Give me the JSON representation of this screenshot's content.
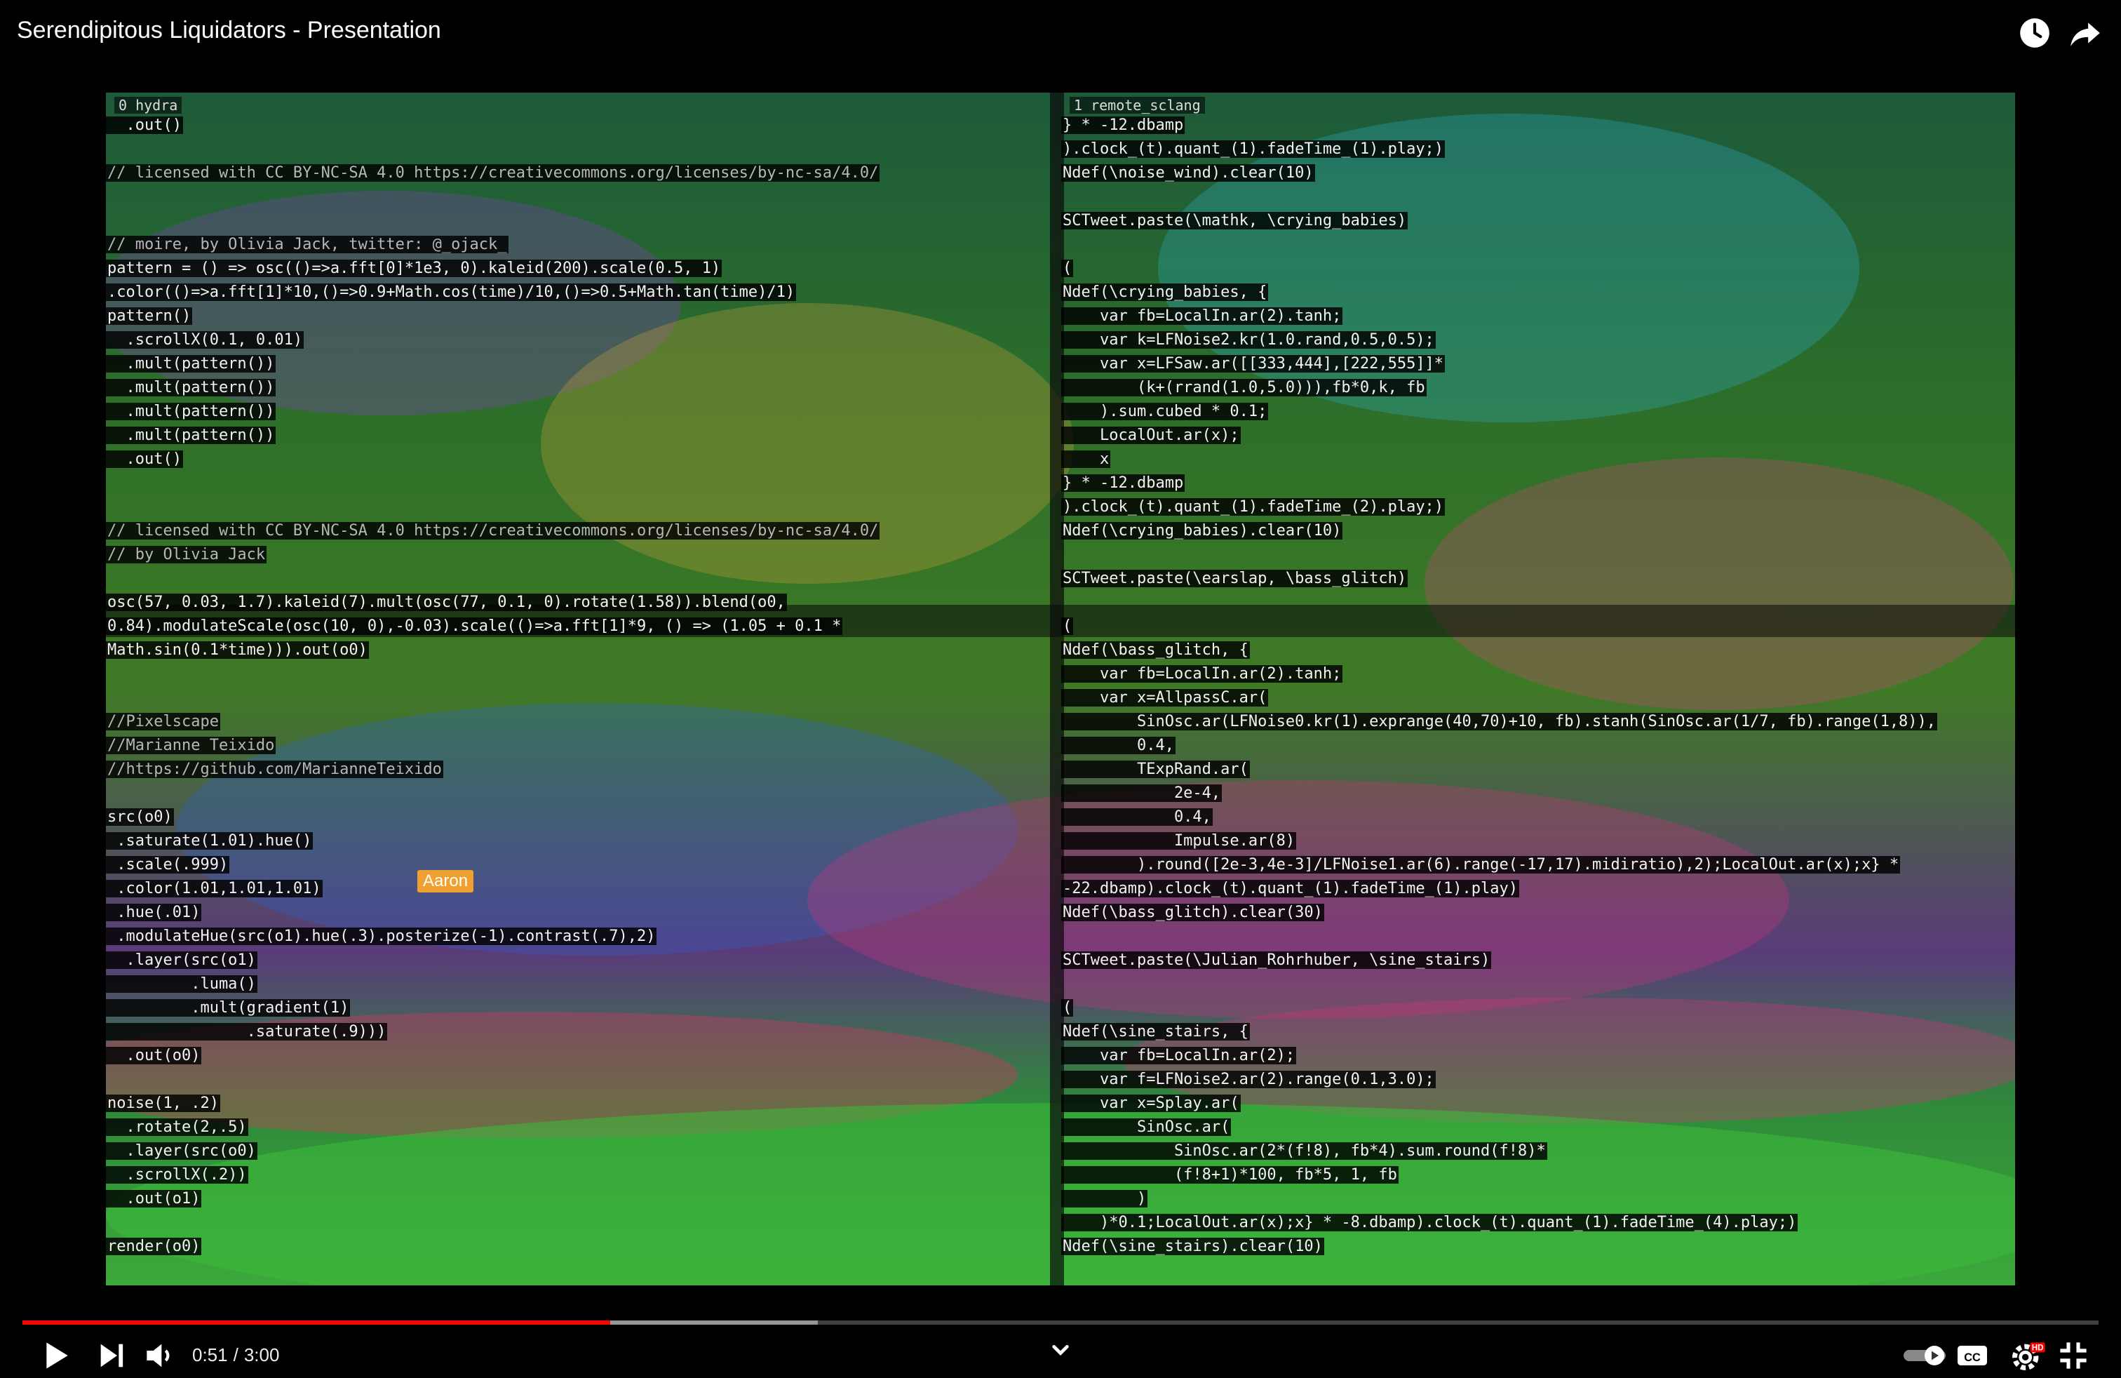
{
  "window": {
    "title": "Serendipitous Liquidators - Presentation"
  },
  "icons": {
    "watch_later": "clock-icon",
    "share": "share-arrow-icon",
    "play": "play-icon",
    "next": "skip-next-icon",
    "volume": "volume-icon",
    "chevron": "chevron-down-icon",
    "autoplay": "autoplay-toggle-icon",
    "captions": "cc-icon",
    "settings": "gear-hd-icon",
    "exit_fullscreen": "exit-fullscreen-icon"
  },
  "settings_badge": "HD",
  "player": {
    "current_time": "0:51",
    "separator": "/",
    "duration": "3:00",
    "played_fraction": 0.283,
    "buffered_fraction": 0.383,
    "accent_color": "#ff0000"
  },
  "left_pane": {
    "label": "0 hydra",
    "cursor_tag": "Aaron",
    "lines": [
      "  .out()",
      "",
      "// licensed with CC BY-NC-SA 4.0 https://creativecommons.org/licenses/by-nc-sa/4.0/",
      "",
      "",
      "// moire, by Olivia Jack, twitter: @_ojack_",
      "pattern = () => osc(()=>a.fft[0]*1e3, 0).kaleid(200).scale(0.5, 1)",
      ".color(()=>a.fft[1]*10,()=>0.9+Math.cos(time)/10,()=>0.5+Math.tan(time)/1)",
      "pattern()",
      "  .scrollX(0.1, 0.01)",
      "  .mult(pattern())",
      "  .mult(pattern())",
      "  .mult(pattern())",
      "  .mult(pattern())",
      "  .out()",
      "",
      "",
      "// licensed with CC BY-NC-SA 4.0 https://creativecommons.org/licenses/by-nc-sa/4.0/",
      "// by Olivia Jack",
      "",
      "osc(57, 0.03, 1.7).kaleid(7).mult(osc(77, 0.1, 0).rotate(1.58)).blend(o0,",
      "0.84).modulateScale(osc(10, 0),-0.03).scale(()=>a.fft[1]*9, () => (1.05 + 0.1 *",
      "Math.sin(0.1*time))).out(o0)",
      "",
      "",
      "//Pixelscape",
      "//Marianne Teixido",
      "//https://github.com/MarianneTeixido",
      "",
      "src(o0)",
      " .saturate(1.01).hue()",
      " .scale(.999)",
      " .color(1.01,1.01,1.01)",
      " .hue(.01)",
      " .modulateHue(src(o1).hue(.3).posterize(-1).contrast(.7),2)",
      "  .layer(src(o1)",
      "         .luma()",
      "         .mult(gradient(1)",
      "               .saturate(.9)))",
      "  .out(o0)",
      "",
      "noise(1, .2)",
      "  .rotate(2,.5)",
      "  .layer(src(o0)",
      "  .scrollX(.2))",
      "  .out(o1)",
      "",
      "render(o0)"
    ]
  },
  "right_pane": {
    "label": "1 remote_sclang",
    "lines": [
      "} * -12.dbamp",
      ").clock_(t).quant_(1).fadeTime_(1).play;)",
      "Ndef(\\noise_wind).clear(10)",
      "",
      "SCTweet.paste(\\mathk, \\crying_babies)",
      "",
      "(",
      "Ndef(\\crying_babies, {",
      "    var fb=LocalIn.ar(2).tanh;",
      "    var k=LFNoise2.kr(1.0.rand,0.5,0.5);",
      "    var x=LFSaw.ar([[333,444],[222,555]]*",
      "        (k+(rrand(1.0,5.0))),fb*0,k, fb",
      "    ).sum.cubed * 0.1;",
      "    LocalOut.ar(x);",
      "    x",
      "} * -12.dbamp",
      ").clock_(t).quant_(1).fadeTime_(2).play;)",
      "Ndef(\\crying_babies).clear(10)",
      "",
      "SCTweet.paste(\\earslap, \\bass_glitch)",
      "",
      "(",
      "Ndef(\\bass_glitch, {",
      "    var fb=LocalIn.ar(2).tanh;",
      "    var x=AllpassC.ar(",
      "        SinOsc.ar(LFNoise0.kr(1).exprange(40,70)+10, fb).stanh(SinOsc.ar(1/7, fb).range(1,8)),",
      "        0.4,",
      "        TExpRand.ar(",
      "            2e-4,",
      "            0.4,",
      "            Impulse.ar(8)",
      "        ).round([2e-3,4e-3]/LFNoise1.ar(6).range(-17,17).midiratio),2);LocalOut.ar(x);x} *",
      "-22.dbamp).clock_(t).quant_(1).fadeTime_(1).play)",
      "Ndef(\\bass_glitch).clear(30)",
      "",
      "SCTweet.paste(\\Julian_Rohrhuber, \\sine_stairs)",
      "",
      "(",
      "Ndef(\\sine_stairs, {",
      "    var fb=LocalIn.ar(2);",
      "    var f=LFNoise2.ar(2).range(0.1,3.0);",
      "    var x=Splay.ar(",
      "        SinOsc.ar(",
      "            SinOsc.ar(2*(f!8), fb*4).sum.round(f!8)*",
      "            (f!8+1)*100, fb*5, 1, fb",
      "        )",
      "    )*0.1;LocalOut.ar(x);x} * -8.dbamp).clock_(t).quant_(1).fadeTime_(4).play;)",
      "Ndef(\\sine_stairs).clear(10)"
    ]
  }
}
